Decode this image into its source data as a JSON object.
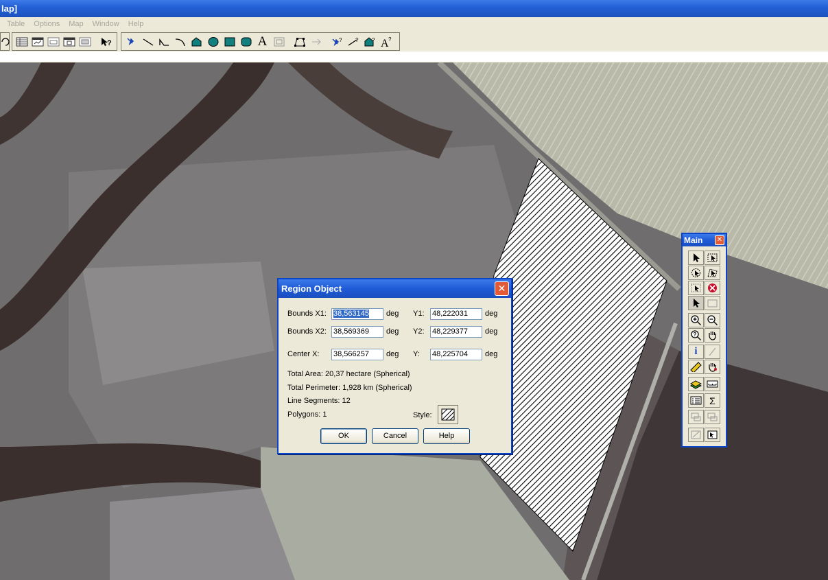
{
  "window": {
    "title": "lap]"
  },
  "menu": {
    "items": [
      "Table",
      "Options",
      "Map",
      "Window",
      "Help"
    ]
  },
  "toolbar": {
    "icons": [
      "undo-icon",
      "browser-icon",
      "map-window-icon",
      "graph-icon",
      "layout-icon",
      "redistrict-icon",
      "help-pointer-icon",
      "symbol-icon",
      "line-icon",
      "polyline-icon",
      "arc-icon",
      "polygon-icon",
      "ellipse-icon",
      "rectangle-icon",
      "rounded-rect-icon",
      "text-icon",
      "frame-icon",
      "reshape-icon",
      "add-node-icon",
      "symbol-style-icon",
      "line-style-icon",
      "region-style-icon",
      "text-style-icon"
    ],
    "text_icon_label": "A",
    "help_label": "?"
  },
  "dialog": {
    "title": "Region Object",
    "bounds_x1_label": "Bounds X1:",
    "bounds_x1": "38,563145",
    "y1_label": "Y1:",
    "y1": "48,222031",
    "bounds_x2_label": "Bounds X2:",
    "bounds_x2": "38,569369",
    "y2_label": "Y2:",
    "y2": "48,229377",
    "center_x_label": "Center X:",
    "center_x": "38,566257",
    "center_y_label": "Y:",
    "center_y": "48,225704",
    "unit": "deg",
    "total_area": "Total Area:  20,37 hectare (Spherical)",
    "total_perimeter": "Total Perimeter:  1,928 km (Spherical)",
    "line_segments": "Line Segments:  12",
    "polygons": "Polygons:  1",
    "style_label": "Style:",
    "ok": "OK",
    "cancel": "Cancel",
    "help": "Help",
    "close": "✕"
  },
  "palette": {
    "title": "Main",
    "close": "✕",
    "info_label": "i",
    "sigma_label": "Σ"
  },
  "colors": {
    "title_blue": "#2461d6",
    "close_red": "#e35b36",
    "face": "#ece9d8"
  }
}
